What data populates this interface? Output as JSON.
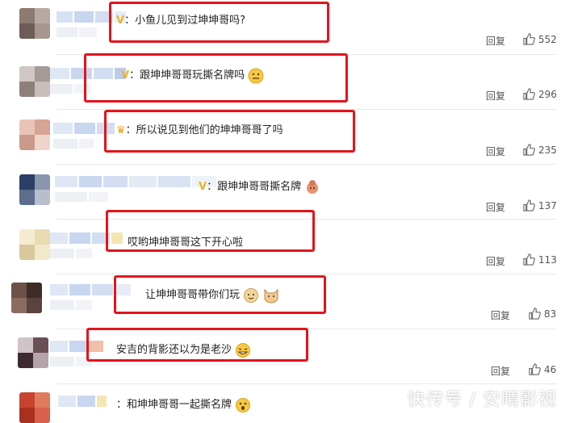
{
  "comments": [
    {
      "text": "：小鱼儿见到过坤坤哥吗?",
      "reply": "回复",
      "likes": "552"
    },
    {
      "text": "：跟坤坤哥哥玩撕名牌吗",
      "reply": "回复",
      "likes": "296"
    },
    {
      "text": "：所以说见到他们的坤坤哥哥了吗",
      "reply": "回复",
      "likes": "235"
    },
    {
      "text": "：跟坤坤哥哥撕名牌",
      "reply": "回复",
      "likes": "137"
    },
    {
      "text": "哎哟坤坤哥哥这下开心啦",
      "reply": "回复",
      "likes": "113"
    },
    {
      "text": "让坤坤哥哥带你们玩",
      "reply": "回复",
      "likes": "83"
    },
    {
      "text": "安吉的背影还以为是老沙",
      "reply": "回复",
      "likes": "46"
    },
    {
      "text": "：和坤坤哥哥一起撕名牌",
      "reply": "",
      "likes": ""
    }
  ],
  "watermark": "快传号 / 安晴影视",
  "colors": {
    "highlight": "#e3141b",
    "blur": "#c9d7ee"
  }
}
